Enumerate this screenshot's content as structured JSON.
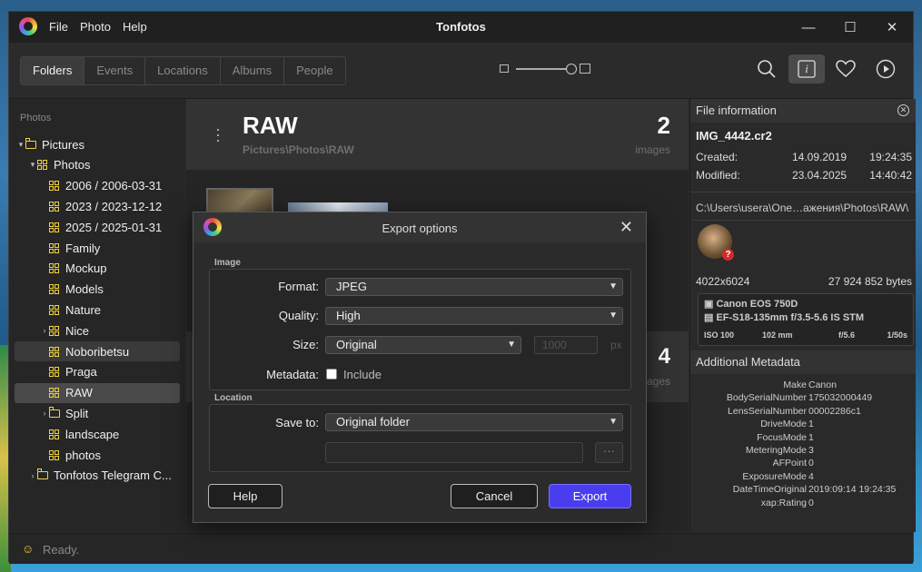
{
  "window": {
    "title": "Tonfotos",
    "menu": [
      "File",
      "Photo",
      "Help"
    ],
    "controls": {
      "minimize": "—",
      "maximize": "☐",
      "close": "✕"
    }
  },
  "toolbar": {
    "tabs": [
      {
        "label": "Folders",
        "active": true
      },
      {
        "label": "Events",
        "active": false
      },
      {
        "label": "Locations",
        "active": false
      },
      {
        "label": "Albums",
        "active": false
      },
      {
        "label": "People",
        "active": false
      }
    ],
    "icons": [
      "search-icon",
      "info-icon",
      "heart-icon",
      "play-icon"
    ],
    "info_glyph": "i"
  },
  "sidebar": {
    "heading": "Photos",
    "items": [
      {
        "label": "Pictures",
        "icon": "folder",
        "expander": "▾"
      },
      {
        "label": "Photos",
        "icon": "album",
        "expander": "▾"
      },
      {
        "label": "2006 / 2006-03-31",
        "icon": "album",
        "expander": ""
      },
      {
        "label": "2023 / 2023-12-12",
        "icon": "album",
        "expander": ""
      },
      {
        "label": "2025 / 2025-01-31",
        "icon": "album",
        "expander": ""
      },
      {
        "label": "Family",
        "icon": "album",
        "expander": ""
      },
      {
        "label": "Mockup",
        "icon": "album",
        "expander": ""
      },
      {
        "label": "Models",
        "icon": "album",
        "expander": ""
      },
      {
        "label": "Nature",
        "icon": "album",
        "expander": ""
      },
      {
        "label": "Nice",
        "icon": "album",
        "expander": "›"
      },
      {
        "label": "Noboribetsu",
        "icon": "album",
        "expander": ""
      },
      {
        "label": "Praga",
        "icon": "album",
        "expander": ""
      },
      {
        "label": "RAW",
        "icon": "album",
        "expander": ""
      },
      {
        "label": "Split",
        "icon": "folder",
        "expander": "›"
      },
      {
        "label": "landscape",
        "icon": "album",
        "expander": ""
      },
      {
        "label": "photos",
        "icon": "album",
        "expander": ""
      },
      {
        "label": "Tonfotos Telegram C...",
        "icon": "folder",
        "expander": "›"
      }
    ]
  },
  "main": {
    "album": {
      "title": "RAW",
      "path": "Pictures\\Photos\\RAW",
      "count": "2",
      "count_label": "images"
    },
    "album2": {
      "count": "4",
      "count_label": "ages"
    }
  },
  "info_panel": {
    "heading": "File information",
    "file_name": "IMG_4442.cr2",
    "created": {
      "label": "Created:",
      "date": "14.09.2019",
      "time": "19:24:35"
    },
    "modified": {
      "label": "Modified:",
      "date": "23.04.2025",
      "time": "14:40:42"
    },
    "path": "C:\\Users\\usera\\One…ажения\\Photos\\RAW\\",
    "badge": "?",
    "resolution": "4022x6024",
    "file_size": "27 924 852 bytes",
    "camera": "Canon EOS 750D",
    "lens": "EF-S18-135mm f/3.5-5.6 IS STM",
    "stats": {
      "iso": "ISO 100",
      "focal": "102 mm",
      "aperture": "f/5.6",
      "shutter": "1/50s"
    },
    "additional_heading": "Additional Metadata",
    "metadata": [
      {
        "key": "Make",
        "value": "Canon"
      },
      {
        "key": "BodySerialNumber",
        "value": "175032000449"
      },
      {
        "key": "LensSerialNumber",
        "value": "00002286c1"
      },
      {
        "key": "DriveMode",
        "value": "1"
      },
      {
        "key": "FocusMode",
        "value": "1"
      },
      {
        "key": "MeteringMode",
        "value": "3"
      },
      {
        "key": "AFPoint",
        "value": "0"
      },
      {
        "key": "ExposureMode",
        "value": "4"
      },
      {
        "key": "DateTimeOriginal",
        "value": "2019:09:14 19:24:35"
      },
      {
        "key": "xap:Rating",
        "value": "0"
      }
    ]
  },
  "status": {
    "text": "Ready."
  },
  "dialog": {
    "title": "Export options",
    "image_group": "Image",
    "format_label": "Format:",
    "format_value": "JPEG",
    "quality_label": "Quality:",
    "quality_value": "High",
    "size_label": "Size:",
    "size_value": "Original",
    "size_placeholder": "1000",
    "size_unit": "px",
    "metadata_label": "Metadata:",
    "include_label": "Include",
    "include_checked": false,
    "location_group": "Location",
    "save_to_label": "Save to:",
    "save_to_value": "Original folder",
    "browse_label": "···",
    "help_button": "Help",
    "cancel_button": "Cancel",
    "export_button": "Export"
  },
  "colors": {
    "accent": "#4a3df0",
    "folder_icon": "#f3d33c",
    "window_bg": "#2b2b2b"
  }
}
